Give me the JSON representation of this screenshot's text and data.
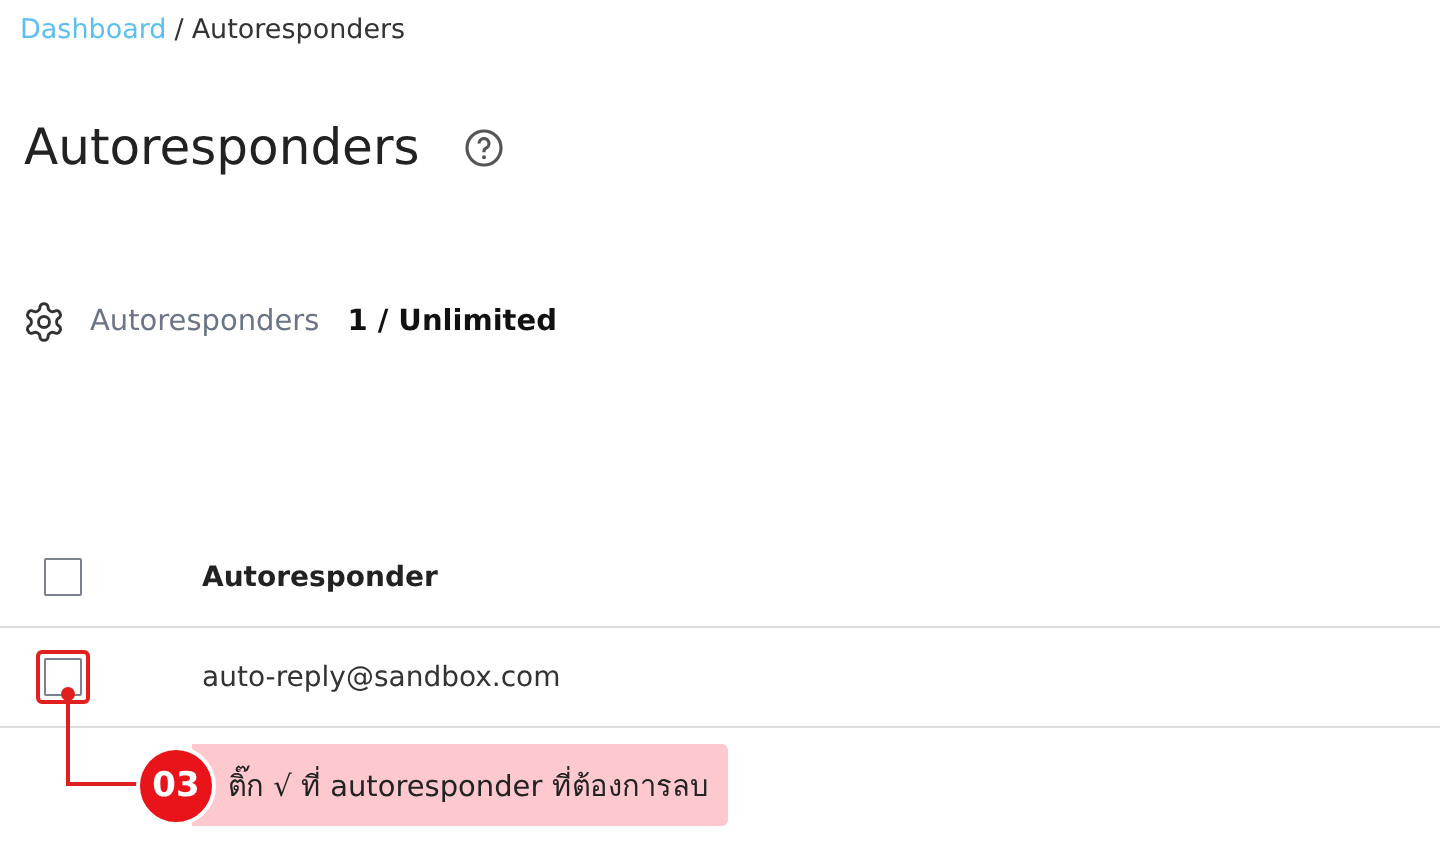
{
  "breadcrumb": {
    "link": "Dashboard",
    "separator": "/",
    "current": "Autoresponders"
  },
  "title": "Autoresponders",
  "quota": {
    "label": "Autoresponders",
    "value": "1 / Unlimited"
  },
  "table": {
    "header": {
      "checked": false,
      "label": "Autoresponder"
    },
    "rows": [
      {
        "checked": false,
        "highlighted": true,
        "address": "auto-reply@sandbox.com"
      }
    ]
  },
  "callout": {
    "number": "03",
    "text": "ติ๊ก √ ที่ autoresponder ที่ต้องการลบ"
  }
}
